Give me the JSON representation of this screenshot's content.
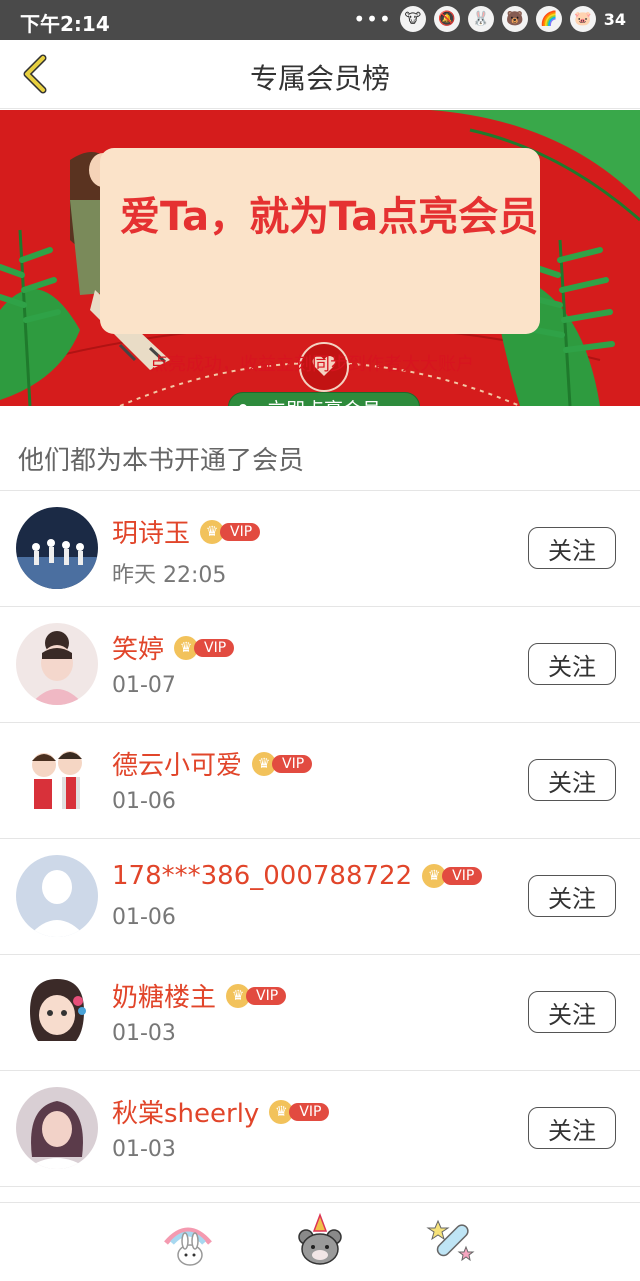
{
  "status": {
    "time": "下午2:14",
    "dots": "•••",
    "battery": "34"
  },
  "header": {
    "title": "专属会员榜"
  },
  "banner": {
    "headline": "爱Ta，就为Ta点亮会员",
    "subtext": "点亮成功，收益立刻同步到作者大大账户",
    "cta": "立即点亮会员"
  },
  "section": {
    "title": "他们都为本书开通了会员"
  },
  "members": [
    {
      "name": "玥诗玉",
      "date": "昨天 22:05",
      "vip": "VIP",
      "follow": "关注"
    },
    {
      "name": "笑婷",
      "date": "01-07",
      "vip": "VIP",
      "follow": "关注"
    },
    {
      "name": "德云小可爱",
      "date": "01-06",
      "vip": "VIP",
      "follow": "关注"
    },
    {
      "name": "178***386_000788722",
      "date": "01-06",
      "vip": "VIP",
      "follow": "关注"
    },
    {
      "name": "奶糖楼主",
      "date": "01-03",
      "vip": "VIP",
      "follow": "关注"
    },
    {
      "name": "秋棠sheerly",
      "date": "01-03",
      "vip": "VIP",
      "follow": "关注"
    }
  ],
  "colors": {
    "accent": "#e1452a",
    "banner_bg": "#d91c1c",
    "cta_green": "#2e8b3c",
    "back_arrow": "#e0c030"
  },
  "icons": [
    "back-arrow-icon",
    "rainbow-bunny-icon",
    "party-bear-icon",
    "magic-wand-icon"
  ]
}
